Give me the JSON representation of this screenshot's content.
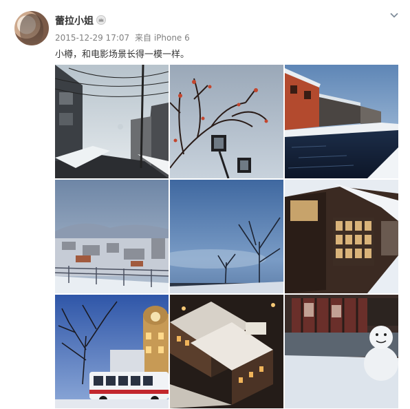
{
  "post": {
    "username": "蕾拉小姐",
    "timestamp": "2015-12-29 17:07",
    "source_prefix": "来自",
    "source": "iPhone 6",
    "text": "小樽，和电影场景长得一模一样。"
  },
  "icons": {
    "vip": "crown-badge-icon",
    "more": "chevron-down-icon"
  },
  "photos": [
    {
      "subject": "snowy street with power lines"
    },
    {
      "subject": "bare tree with red berries and street lamp"
    },
    {
      "subject": "Otaru canal with brick warehouses"
    },
    {
      "subject": "snowy town view from hill"
    },
    {
      "subject": "misty blue sky with bare trees"
    },
    {
      "subject": "snow-covered wooden building"
    },
    {
      "subject": "night street with bus and clock tower"
    },
    {
      "subject": "snowy rooftops at night"
    },
    {
      "subject": "shop window with snowman"
    }
  ],
  "colors": {
    "username": "#333333",
    "meta": "#808080",
    "text": "#333333"
  }
}
